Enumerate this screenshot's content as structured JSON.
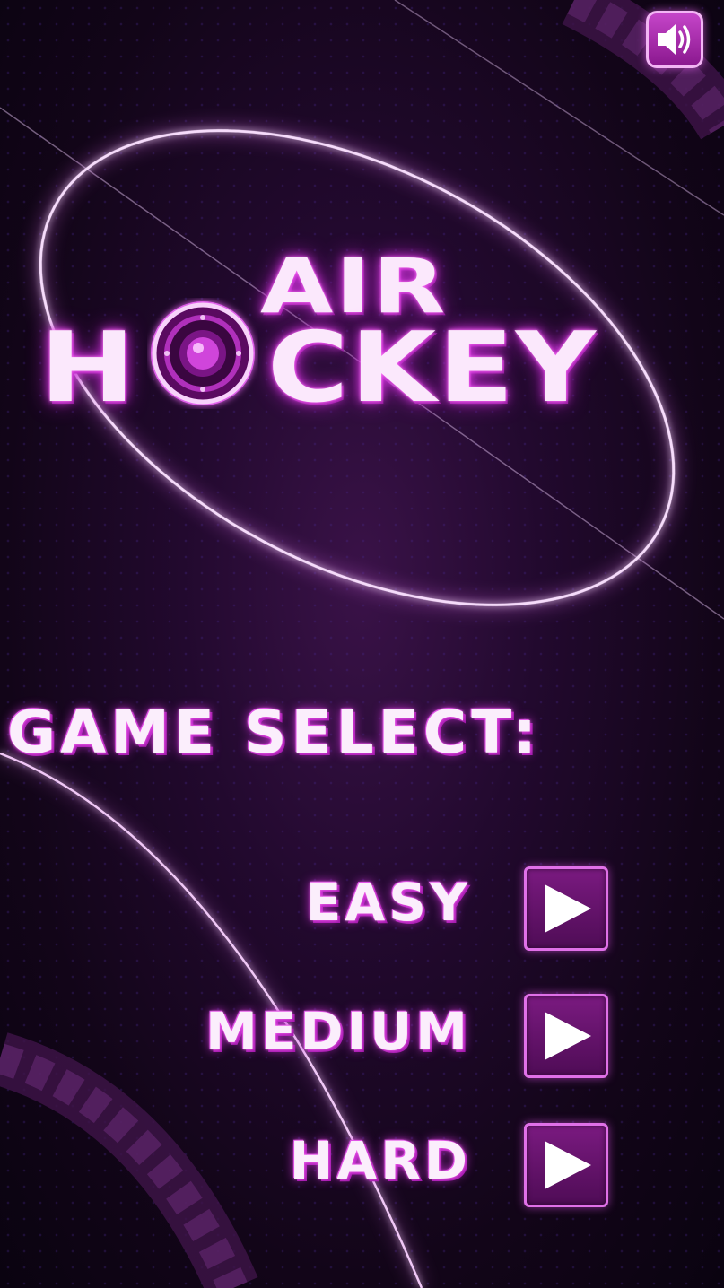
{
  "title": {
    "line1": "AIR",
    "line2_prefix": "H",
    "line2_suffix": "CKEY"
  },
  "game_select": {
    "heading": "GAME SELECT:",
    "levels": [
      {
        "label": "EASY"
      },
      {
        "label": "MEDIUM"
      },
      {
        "label": "HARD"
      }
    ]
  },
  "icons": {
    "sound": "speaker-icon",
    "play": "play-icon",
    "logo_puck": "puck-icon"
  },
  "colors": {
    "accent": "#e040e8",
    "button_fill": "#6a1470",
    "text": "#fbeefc",
    "background": "#1a0622"
  }
}
